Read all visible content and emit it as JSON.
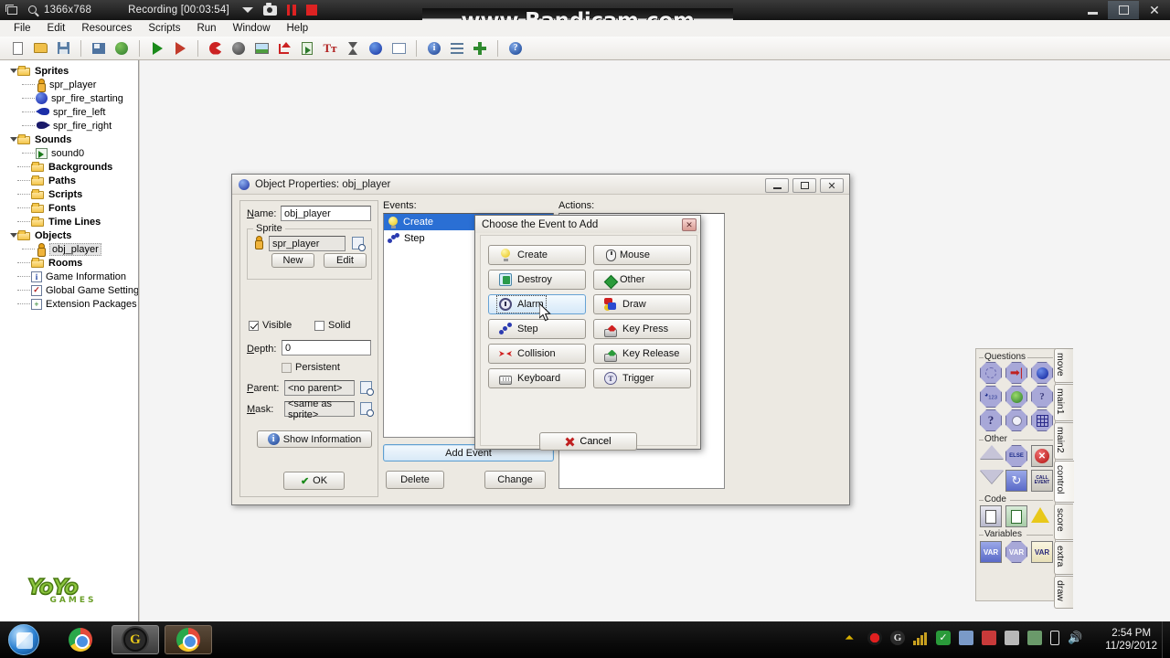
{
  "recorder": {
    "resolution": "1366x768",
    "status": "Recording [00:03:54]",
    "watermark": "www.Bandicam.com",
    "icons": [
      "window-restore-icon",
      "magnifier-icon",
      "caret-down-icon",
      "camera-icon",
      "pause-icon",
      "stop-icon"
    ]
  },
  "window": {
    "controls": [
      "minimize",
      "maximize",
      "close"
    ],
    "close_glyph": "✕"
  },
  "menubar": {
    "items": [
      "File",
      "Edit",
      "Resources",
      "Scripts",
      "Run",
      "Window",
      "Help"
    ]
  },
  "toolbar": {
    "buttons": [
      {
        "name": "new-icon"
      },
      {
        "name": "open-icon"
      },
      {
        "name": "save-icon"
      },
      {
        "name": "save-as-icon"
      },
      {
        "name": "publish-globe-icon"
      },
      {
        "name": "run-icon"
      },
      {
        "name": "run-debug-icon"
      },
      {
        "name": "create-sprite-icon"
      },
      {
        "name": "create-sound-icon"
      },
      {
        "name": "create-background-icon"
      },
      {
        "name": "create-path-icon"
      },
      {
        "name": "create-script-icon"
      },
      {
        "name": "create-font-icon"
      },
      {
        "name": "create-timeline-icon"
      },
      {
        "name": "create-object-icon"
      },
      {
        "name": "create-room-icon"
      },
      {
        "name": "game-information-icon"
      },
      {
        "name": "global-game-settings-icon"
      },
      {
        "name": "extension-packages-icon"
      },
      {
        "name": "help-icon"
      }
    ]
  },
  "tree": {
    "nodes": [
      {
        "label": "Sprites",
        "type": "folder",
        "expanded": true,
        "icon": "folder-icon"
      },
      {
        "label": "spr_player",
        "type": "leaf",
        "depth": 1,
        "icon": "sprite-player-icon"
      },
      {
        "label": "spr_fire_starting",
        "type": "leaf",
        "depth": 1,
        "icon": "sprite-ball-icon"
      },
      {
        "label": "spr_fire_left",
        "type": "leaf",
        "depth": 1,
        "icon": "sprite-fire-left-icon"
      },
      {
        "label": "spr_fire_right",
        "type": "leaf",
        "depth": 1,
        "icon": "sprite-fire-right-icon"
      },
      {
        "label": "Sounds",
        "type": "folder",
        "expanded": true,
        "icon": "folder-icon"
      },
      {
        "label": "sound0",
        "type": "leaf",
        "depth": 1,
        "icon": "sound-icon"
      },
      {
        "label": "Backgrounds",
        "type": "folder",
        "expanded": false,
        "icon": "folder-icon"
      },
      {
        "label": "Paths",
        "type": "folder",
        "expanded": false,
        "icon": "folder-icon"
      },
      {
        "label": "Scripts",
        "type": "folder",
        "expanded": false,
        "icon": "folder-icon"
      },
      {
        "label": "Fonts",
        "type": "folder",
        "expanded": false,
        "icon": "folder-icon"
      },
      {
        "label": "Time Lines",
        "type": "folder",
        "expanded": false,
        "icon": "folder-icon"
      },
      {
        "label": "Objects",
        "type": "folder",
        "expanded": true,
        "icon": "folder-icon"
      },
      {
        "label": "obj_player",
        "type": "leaf",
        "depth": 1,
        "selected": true,
        "icon": "object-player-icon"
      },
      {
        "label": "Rooms",
        "type": "folder",
        "expanded": false,
        "icon": "folder-icon"
      },
      {
        "label": "Game Information",
        "type": "item",
        "icon": "info-icon"
      },
      {
        "label": "Global Game Settings",
        "type": "item",
        "icon": "check-icon"
      },
      {
        "label": "Extension Packages",
        "type": "item",
        "icon": "plus-icon"
      }
    ],
    "logo": {
      "line1": "YoYo",
      "line2": "GAMES"
    }
  },
  "object_dialog": {
    "title": "Object Properties: obj_player",
    "name_label": "Name:",
    "name_value": "obj_player",
    "sprite_group": "Sprite",
    "sprite_value": "spr_player",
    "sprite_new": "New",
    "sprite_edit": "Edit",
    "visible_label": "Visible",
    "visible_checked": true,
    "solid_label": "Solid",
    "solid_checked": false,
    "depth_label": "Depth:",
    "depth_value": "0",
    "persistent_label": "Persistent",
    "persistent_checked": false,
    "parent_label": "Parent:",
    "parent_value": "<no parent>",
    "mask_label": "Mask:",
    "mask_value": "<same as sprite>",
    "show_information": "Show Information",
    "ok": "OK",
    "events_label": "Events:",
    "actions_label": "Actions:",
    "events": [
      {
        "label": "Create",
        "icon": "create-event-icon",
        "selected": true
      },
      {
        "label": "Step",
        "icon": "step-event-icon",
        "selected": false
      }
    ],
    "add_event": "Add Event",
    "delete": "Delete",
    "change": "Change"
  },
  "event_dialog": {
    "title": "Choose the Event to Add",
    "close_glyph": "✕",
    "buttons_left": [
      {
        "label": "Create",
        "icon": "create-event-icon",
        "hover": false
      },
      {
        "label": "Destroy",
        "icon": "destroy-event-icon",
        "hover": false
      },
      {
        "label": "Alarm",
        "icon": "alarm-event-icon",
        "hover": true
      },
      {
        "label": "Step",
        "icon": "step-event-icon",
        "hover": false
      },
      {
        "label": "Collision",
        "icon": "collision-event-icon",
        "hover": false
      },
      {
        "label": "Keyboard",
        "icon": "keyboard-event-icon",
        "hover": false
      }
    ],
    "buttons_right": [
      {
        "label": "Mouse",
        "icon": "mouse-event-icon",
        "hover": false
      },
      {
        "label": "Other",
        "icon": "other-event-icon",
        "hover": false
      },
      {
        "label": "Draw",
        "icon": "draw-event-icon",
        "hover": false
      },
      {
        "label": "Key Press",
        "icon": "key-press-event-icon",
        "hover": false
      },
      {
        "label": "Key Release",
        "icon": "key-release-event-icon",
        "hover": false
      },
      {
        "label": "Trigger",
        "icon": "trigger-event-icon",
        "hover": false
      }
    ],
    "cancel": "Cancel"
  },
  "action_palette": {
    "tabs": [
      {
        "label": "move",
        "active": false
      },
      {
        "label": "main1",
        "active": false
      },
      {
        "label": "main2",
        "active": false
      },
      {
        "label": "control",
        "active": true
      },
      {
        "label": "score",
        "active": false
      },
      {
        "label": "extra",
        "active": false
      },
      {
        "label": "draw",
        "active": false
      }
    ],
    "groups": [
      {
        "label": "Questions",
        "icons": [
          "check-empty-action-icon",
          "check-object-action-icon",
          "check-instance-action-icon",
          "check-number-action-icon",
          "check-chance-action-icon",
          "check-question-action-icon",
          "ask-question-action-icon",
          "test-expression-action-icon",
          "check-grid-action-icon"
        ]
      },
      {
        "label": "Other",
        "icons": [
          "start-block-action-icon",
          "else-action-icon",
          "exit-event-action-icon",
          "end-block-action-icon",
          "repeat-action-icon",
          "call-event-action-icon"
        ]
      },
      {
        "label": "Code",
        "icons": [
          "execute-code-action-icon",
          "execute-script-action-icon",
          "comment-action-icon"
        ]
      },
      {
        "label": "Variables",
        "icons": [
          "set-variable-action-icon",
          "test-variable-action-icon",
          "draw-variable-action-icon"
        ]
      }
    ]
  },
  "taskbar": {
    "start": "start-orb-icon",
    "items": [
      {
        "name": "chrome-taskbar-icon",
        "active": false
      },
      {
        "name": "gamemaker-taskbar-icon",
        "active": true
      },
      {
        "name": "chrome-window-taskbar-icon",
        "active": true
      }
    ],
    "tray_icons": [
      "tray-arrow-icon",
      "bandicam-record-icon",
      "google-icon",
      "signal-icon",
      "antivirus-icon",
      "update-icon",
      "security-icon",
      "display-icon",
      "printer-icon",
      "battery-icon",
      "volume-icon"
    ],
    "time": "2:54 PM",
    "date": "11/29/2012"
  }
}
